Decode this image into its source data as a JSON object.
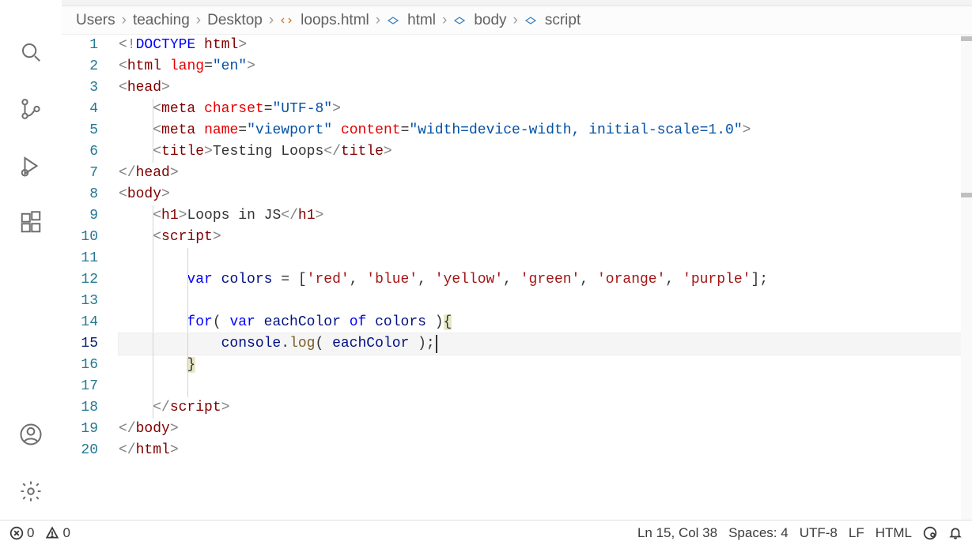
{
  "breadcrumb": {
    "items": [
      "Users",
      "teaching",
      "Desktop",
      "loops.html",
      "html",
      "body",
      "script"
    ]
  },
  "code": {
    "lines": [
      {
        "n": 1,
        "tokens": [
          [
            "<!",
            "gray"
          ],
          [
            "DOCTYPE",
            "doct"
          ],
          [
            " ",
            "txt"
          ],
          [
            "html",
            "tag"
          ],
          [
            ">",
            "gray"
          ]
        ]
      },
      {
        "n": 2,
        "tokens": [
          [
            "<",
            "gray"
          ],
          [
            "html",
            "tag"
          ],
          [
            " ",
            "txt"
          ],
          [
            "lang",
            "attr"
          ],
          [
            "=",
            "txt"
          ],
          [
            "\"en\"",
            "str"
          ],
          [
            ">",
            "gray"
          ]
        ]
      },
      {
        "n": 3,
        "tokens": [
          [
            "<",
            "gray"
          ],
          [
            "head",
            "tag"
          ],
          [
            ">",
            "gray"
          ]
        ]
      },
      {
        "n": 4,
        "tokens": [
          [
            "    ",
            "txt"
          ],
          [
            "<",
            "gray"
          ],
          [
            "meta",
            "tag"
          ],
          [
            " ",
            "txt"
          ],
          [
            "charset",
            "attr"
          ],
          [
            "=",
            "txt"
          ],
          [
            "\"UTF-8\"",
            "str"
          ],
          [
            ">",
            "gray"
          ]
        ]
      },
      {
        "n": 5,
        "tokens": [
          [
            "    ",
            "txt"
          ],
          [
            "<",
            "gray"
          ],
          [
            "meta",
            "tag"
          ],
          [
            " ",
            "txt"
          ],
          [
            "name",
            "attr"
          ],
          [
            "=",
            "txt"
          ],
          [
            "\"viewport\"",
            "str"
          ],
          [
            " ",
            "txt"
          ],
          [
            "content",
            "attr"
          ],
          [
            "=",
            "txt"
          ],
          [
            "\"width=device-width, initial-scale=1.0\"",
            "str"
          ],
          [
            ">",
            "gray"
          ]
        ]
      },
      {
        "n": 6,
        "tokens": [
          [
            "    ",
            "txt"
          ],
          [
            "<",
            "gray"
          ],
          [
            "title",
            "tag"
          ],
          [
            ">",
            "gray"
          ],
          [
            "Testing Loops",
            "txt"
          ],
          [
            "</",
            "gray"
          ],
          [
            "title",
            "tag"
          ],
          [
            ">",
            "gray"
          ]
        ]
      },
      {
        "n": 7,
        "tokens": [
          [
            "</",
            "gray"
          ],
          [
            "head",
            "tag"
          ],
          [
            ">",
            "gray"
          ]
        ]
      },
      {
        "n": 8,
        "tokens": [
          [
            "<",
            "gray"
          ],
          [
            "body",
            "tag"
          ],
          [
            ">",
            "gray"
          ]
        ]
      },
      {
        "n": 9,
        "tokens": [
          [
            "    ",
            "txt"
          ],
          [
            "<",
            "gray"
          ],
          [
            "h1",
            "tag"
          ],
          [
            ">",
            "gray"
          ],
          [
            "Loops in JS",
            "txt"
          ],
          [
            "</",
            "gray"
          ],
          [
            "h1",
            "tag"
          ],
          [
            ">",
            "gray"
          ]
        ]
      },
      {
        "n": 10,
        "tokens": [
          [
            "    ",
            "txt"
          ],
          [
            "<",
            "gray"
          ],
          [
            "script",
            "tag"
          ],
          [
            ">",
            "gray"
          ]
        ]
      },
      {
        "n": 11,
        "tokens": [
          [
            "",
            "txt"
          ]
        ]
      },
      {
        "n": 12,
        "tokens": [
          [
            "        ",
            "txt"
          ],
          [
            "var",
            "kw"
          ],
          [
            " ",
            "txt"
          ],
          [
            "colors",
            "var"
          ],
          [
            " = [",
            "txt"
          ],
          [
            "'red'",
            "sstr"
          ],
          [
            ", ",
            "txt"
          ],
          [
            "'blue'",
            "sstr"
          ],
          [
            ", ",
            "txt"
          ],
          [
            "'yellow'",
            "sstr"
          ],
          [
            ", ",
            "txt"
          ],
          [
            "'green'",
            "sstr"
          ],
          [
            ", ",
            "txt"
          ],
          [
            "'orange'",
            "sstr"
          ],
          [
            ", ",
            "txt"
          ],
          [
            "'purple'",
            "sstr"
          ],
          [
            "];",
            "txt"
          ]
        ]
      },
      {
        "n": 13,
        "tokens": [
          [
            "",
            "txt"
          ]
        ]
      },
      {
        "n": 14,
        "tokens": [
          [
            "        ",
            "txt"
          ],
          [
            "for",
            "kw"
          ],
          [
            "( ",
            "txt"
          ],
          [
            "var",
            "kw"
          ],
          [
            " ",
            "txt"
          ],
          [
            "eachColor",
            "var"
          ],
          [
            " ",
            "txt"
          ],
          [
            "of",
            "kw"
          ],
          [
            " ",
            "txt"
          ],
          [
            "colors",
            "var"
          ],
          [
            " )",
            "txt"
          ],
          [
            "{",
            "txt brk"
          ]
        ]
      },
      {
        "n": 15,
        "active": true,
        "cursorCol": 38,
        "tokens": [
          [
            "            ",
            "txt"
          ],
          [
            "console",
            "var"
          ],
          [
            ".",
            "txt"
          ],
          [
            "log",
            "func"
          ],
          [
            "( ",
            "txt"
          ],
          [
            "eachColor",
            "var"
          ],
          [
            " );",
            "txt"
          ]
        ]
      },
      {
        "n": 16,
        "tokens": [
          [
            "        ",
            "txt"
          ],
          [
            "}",
            "txt brk"
          ]
        ]
      },
      {
        "n": 17,
        "tokens": [
          [
            "",
            "txt"
          ]
        ]
      },
      {
        "n": 18,
        "tokens": [
          [
            "    ",
            "txt"
          ],
          [
            "</",
            "gray"
          ],
          [
            "script",
            "tag"
          ],
          [
            ">",
            "gray"
          ]
        ]
      },
      {
        "n": 19,
        "tokens": [
          [
            "</",
            "gray"
          ],
          [
            "body",
            "tag"
          ],
          [
            ">",
            "gray"
          ]
        ]
      },
      {
        "n": 20,
        "tokens": [
          [
            "</",
            "gray"
          ],
          [
            "html",
            "tag"
          ],
          [
            ">",
            "gray"
          ]
        ]
      }
    ]
  },
  "status": {
    "errors": "0",
    "warnings": "0",
    "cursor": "Ln 15, Col 38",
    "spaces": "Spaces: 4",
    "encoding": "UTF-8",
    "eol": "LF",
    "lang": "HTML"
  }
}
